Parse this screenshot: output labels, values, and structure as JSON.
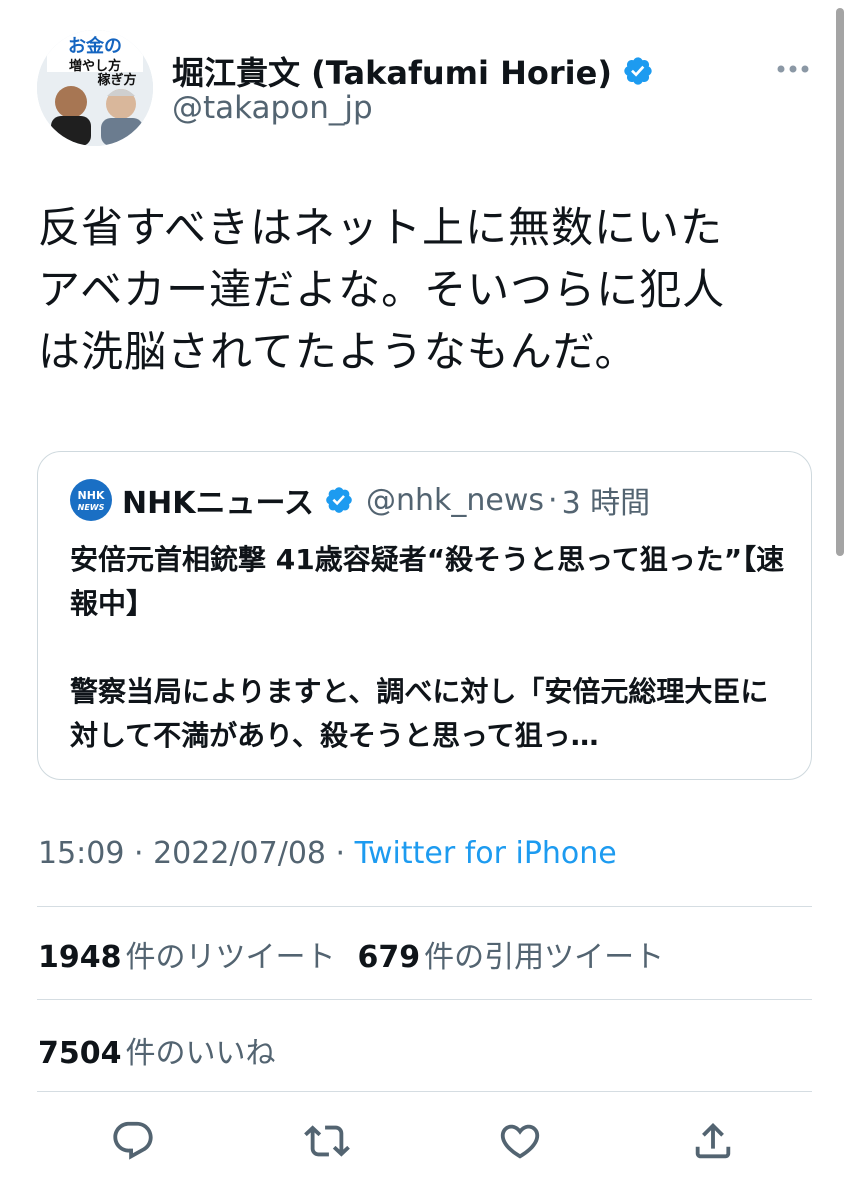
{
  "author": {
    "display_name": "堀江貴文 (Takafumi Horie)",
    "handle": "@takapon_jp",
    "verified_icon": "verified-badge-icon",
    "avatar_book_title_line1": "お金の",
    "avatar_book_title_line2": "増やし方",
    "avatar_book_title_line3": "稼ぎ方"
  },
  "tweet": {
    "text": "反省すべきはネット上に無数にいた\nアベカー達だよな。そいつらに犯人\nは洗脳されてたようなもんだ。"
  },
  "quote": {
    "logo_text_top": "NHK",
    "logo_text_bottom": "NEWS",
    "name": "NHKニュース",
    "handle": "@nhk_news",
    "separator": "·",
    "time": "3 時間",
    "body": "安倍元首相銃撃 41歳容疑者“殺そうと思って狙った”【速報中】\n\n警察当局によりますと、調べに対し「安倍元総理大臣に対して不満があり、殺そうと思って狙っ…"
  },
  "meta": {
    "time": "15:09",
    "dot1": " · ",
    "date": "2022/07/08",
    "dot2": " · ",
    "source": "Twitter for iPhone"
  },
  "stats": {
    "retweets_count": "1948",
    "retweets_label": "件のリツイート",
    "quotes_count": "679",
    "quotes_label": "件の引用ツイート",
    "likes_count": "7504",
    "likes_label": "件のいいね"
  },
  "actions": [
    "reply-icon",
    "retweet-icon",
    "like-icon",
    "share-icon"
  ],
  "colors": {
    "accent": "#1d9bf0",
    "text": "#0f1419",
    "secondary": "#536471",
    "border": "#cfd9de",
    "nhk_blue": "#1a6fc4"
  }
}
